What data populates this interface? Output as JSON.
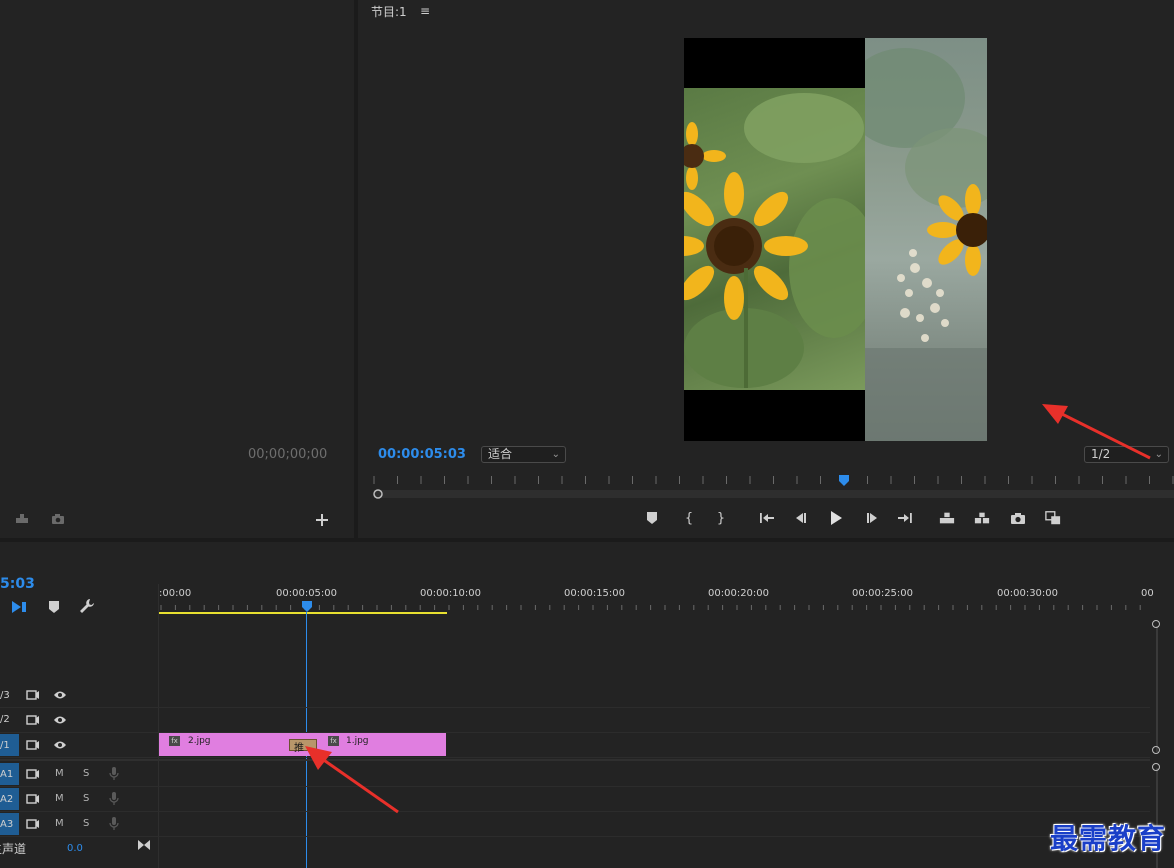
{
  "source_panel": {
    "timecode": "00;00;00;00"
  },
  "program_monitor": {
    "title": "节目:1",
    "timecode": "00:00:05:03",
    "fit_dropdown": "适合",
    "quality_dropdown": "1/2"
  },
  "timeline": {
    "timecode": "5:03",
    "ruler_labels": [
      ":00:00",
      "00:00:05:00",
      "00:00:10:00",
      "00:00:15:00",
      "00:00:20:00",
      "00:00:25:00",
      "00:00:30:00",
      "00"
    ],
    "video_tracks": [
      {
        "name": "/3"
      },
      {
        "name": "/2"
      },
      {
        "name": "/1"
      }
    ],
    "audio_tracks": [
      {
        "name": "A1",
        "mute": "M",
        "solo": "S"
      },
      {
        "name": "A2",
        "mute": "M",
        "solo": "S"
      },
      {
        "name": "A3",
        "mute": "M",
        "solo": "S"
      }
    ],
    "master": {
      "label": "主声道",
      "value": "0.0"
    },
    "clips": [
      {
        "name": "2.jpg"
      },
      {
        "name": "1.jpg"
      }
    ],
    "transition_label": "推"
  },
  "watermark": "最需教育",
  "colors": {
    "accent_blue": "#2d8ceb",
    "clip_pink": "#e07ee0",
    "work_area_yellow": "#e8e030",
    "annotation_red": "#e8302a",
    "watermark_blue": "#1a3fc8"
  }
}
